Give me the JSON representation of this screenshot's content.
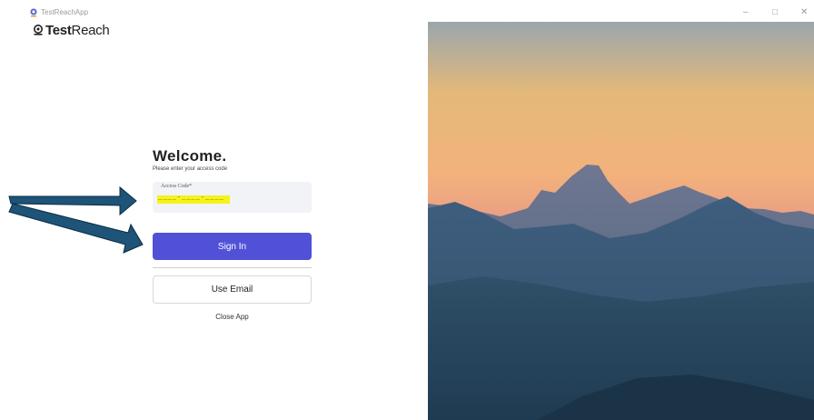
{
  "window": {
    "title": "TestReachApp",
    "controls": {
      "minimize": "–",
      "maximize": "□",
      "close": "✕"
    }
  },
  "brand": {
    "bold": "Test",
    "regular": "Reach",
    "icon": "testreach-logo-icon"
  },
  "login": {
    "heading": "Welcome.",
    "subtitle": "Please enter your access code",
    "field_label": "Access Code*",
    "code_value": "____-____-____",
    "sign_in_label": "Sign In",
    "use_email_label": "Use Email",
    "close_app_label": "Close App"
  },
  "colors": {
    "primary": "#5151d8",
    "highlight": "#f5f31a",
    "arrow_fill": "#1d5478",
    "field_bg": "#f1f3f7"
  }
}
